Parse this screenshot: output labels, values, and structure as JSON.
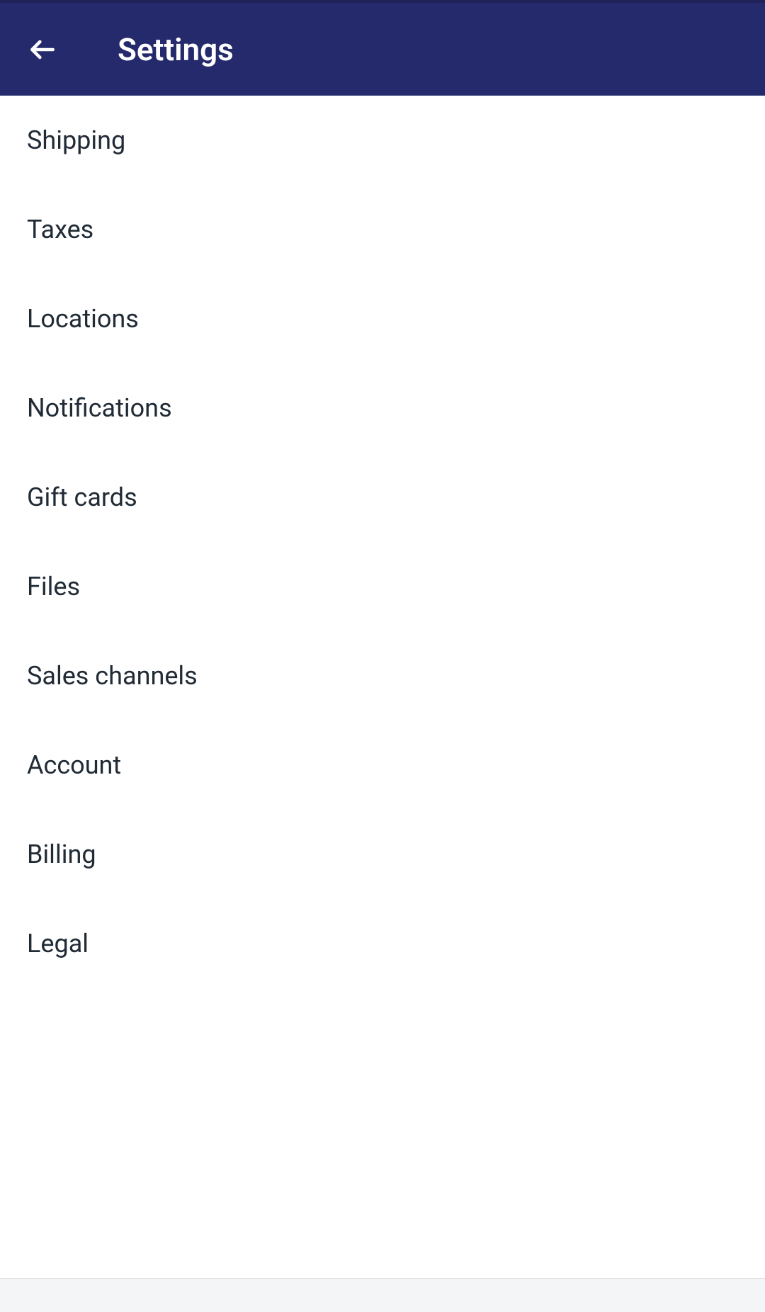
{
  "header": {
    "title": "Settings"
  },
  "settings": {
    "items": [
      {
        "label": "Shipping"
      },
      {
        "label": "Taxes"
      },
      {
        "label": "Locations"
      },
      {
        "label": "Notifications"
      },
      {
        "label": "Gift cards"
      },
      {
        "label": "Files"
      },
      {
        "label": "Sales channels"
      },
      {
        "label": "Account"
      },
      {
        "label": "Billing"
      },
      {
        "label": "Legal"
      }
    ]
  }
}
